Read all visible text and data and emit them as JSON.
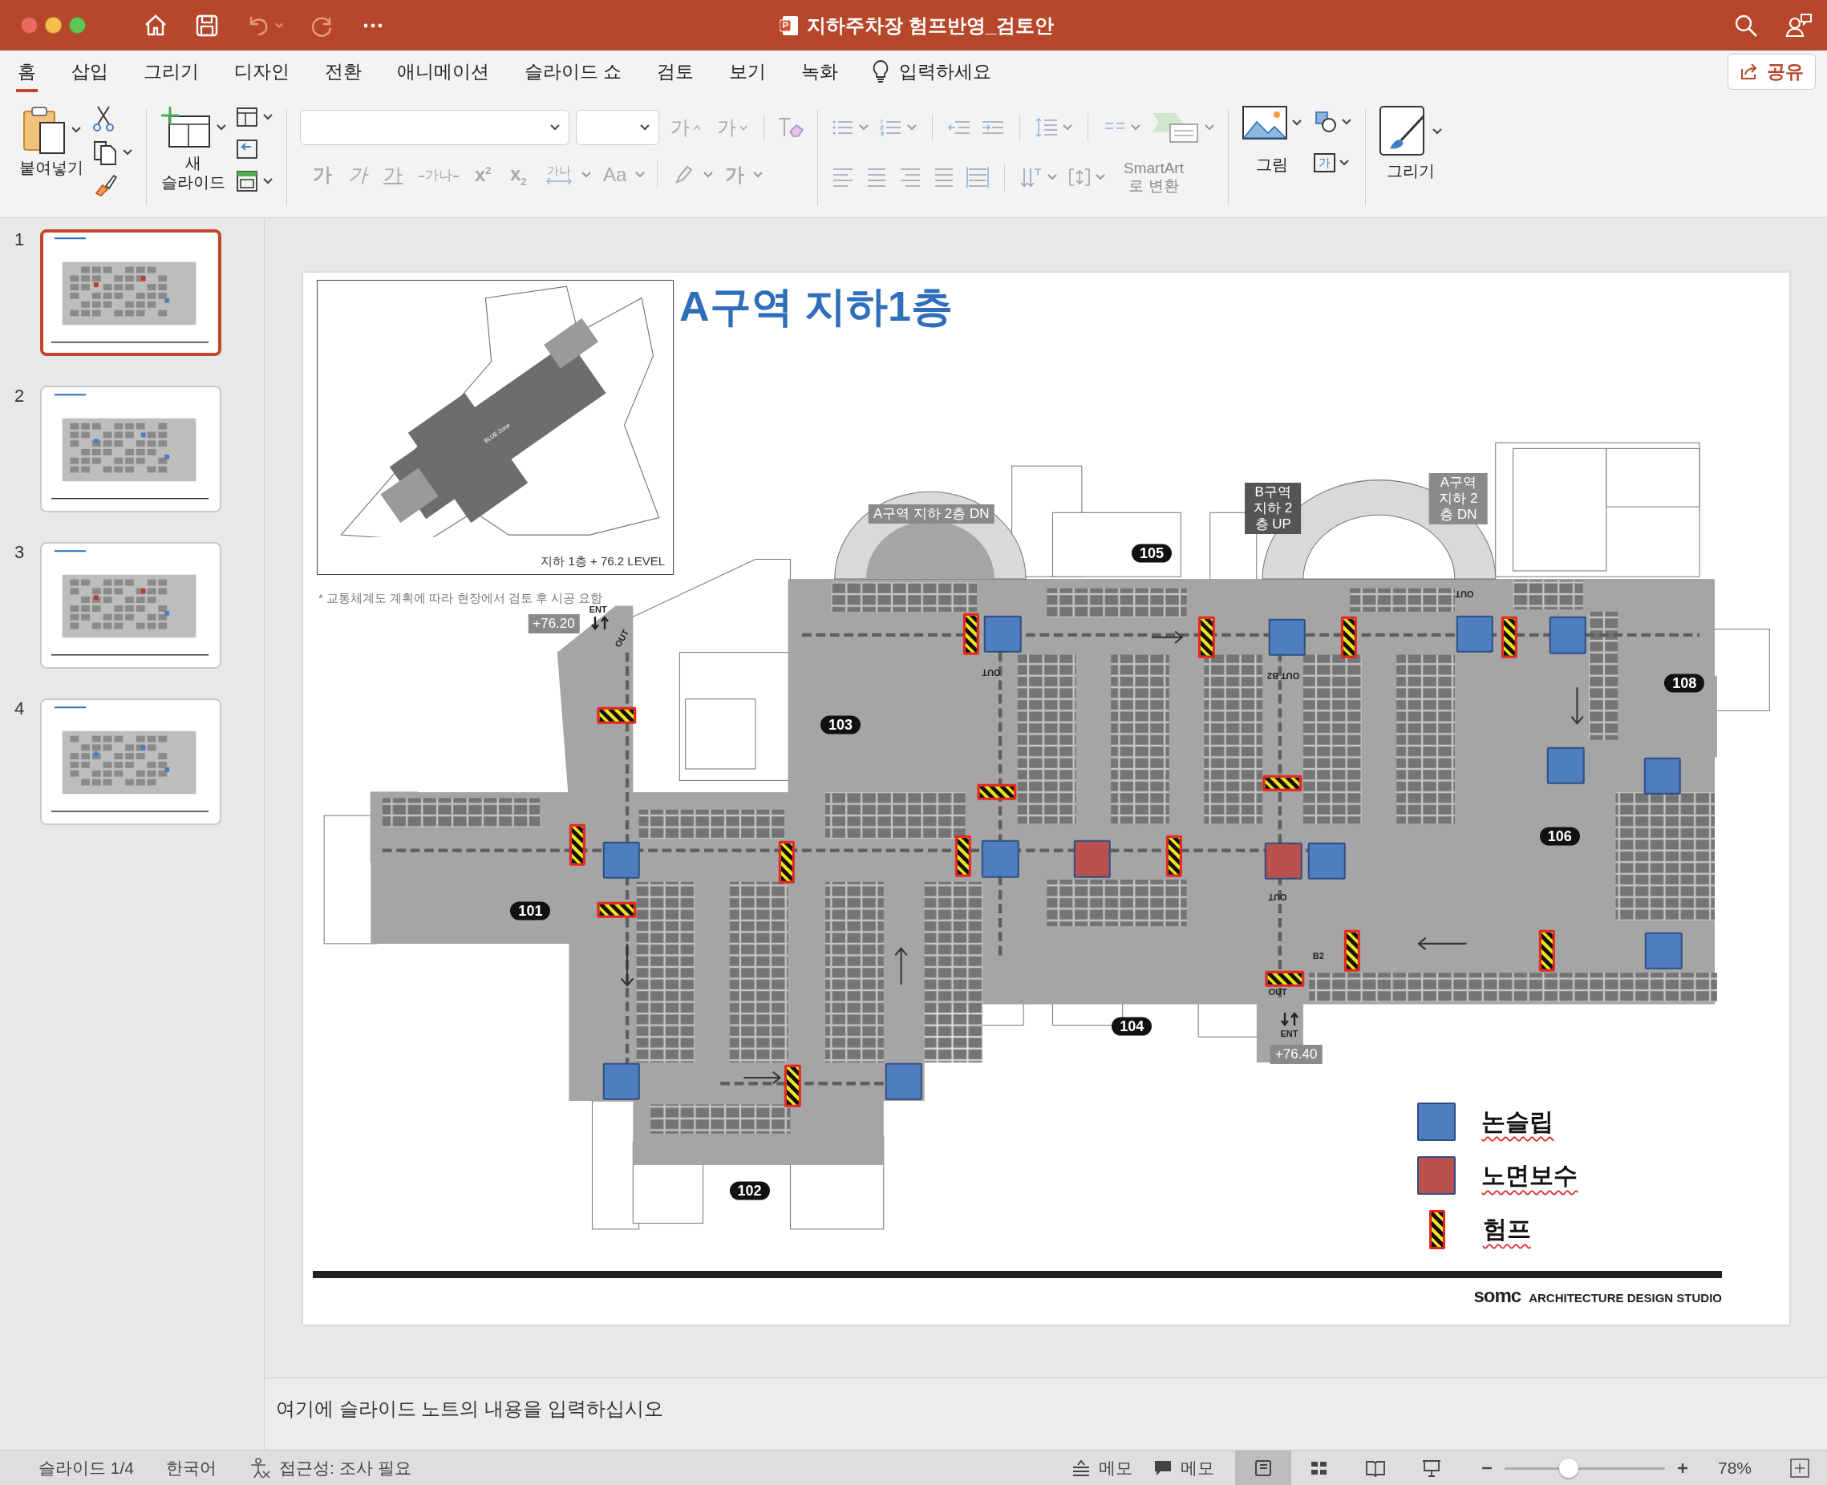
{
  "window": {
    "title": "지하주차장 험프반영_검토안"
  },
  "quick_access": [
    {
      "kind": "home",
      "disabled": false
    },
    {
      "kind": "save",
      "disabled": false
    },
    {
      "kind": "undo",
      "disabled": true
    },
    {
      "kind": "redo",
      "disabled": true
    },
    {
      "kind": "more",
      "disabled": false
    }
  ],
  "tabs": [
    {
      "label": "홈",
      "selected": true
    },
    {
      "label": "삽입",
      "selected": false
    },
    {
      "label": "그리기",
      "selected": false
    },
    {
      "label": "디자인",
      "selected": false
    },
    {
      "label": "전환",
      "selected": false
    },
    {
      "label": "애니메이션",
      "selected": false
    },
    {
      "label": "슬라이드 쇼",
      "selected": false
    },
    {
      "label": "검토",
      "selected": false
    },
    {
      "label": "보기",
      "selected": false
    },
    {
      "label": "녹화",
      "selected": false
    }
  ],
  "tell_me": {
    "label": "입력하세요"
  },
  "share_button": {
    "label": "공유"
  },
  "ribbon": {
    "paste": "붙여넣기",
    "new_slide": "새 슬라이드",
    "smartart": "SmartArt 로 변환",
    "picture": "그림",
    "draw": "그리기",
    "size_buttons": [
      {
        "kind": "grow",
        "text": "가",
        "disabled": true
      },
      {
        "kind": "shrink",
        "text": "가",
        "disabled": true
      }
    ],
    "font_buttons": [
      {
        "kind": "bold",
        "text": "가",
        "disabled": true
      },
      {
        "kind": "italic",
        "text": "가",
        "disabled": true
      },
      {
        "kind": "underline",
        "text": "가",
        "disabled": true
      },
      {
        "kind": "strike",
        "text": "가나",
        "disabled": true
      },
      {
        "kind": "superscript",
        "text": "x$^{2}$",
        "disabled": true
      },
      {
        "kind": "subscript",
        "text": "x$_{2}$",
        "disabled": true
      },
      {
        "kind": "spacing",
        "text": "가나",
        "disabled": true
      },
      {
        "kind": "case",
        "text": "Aa",
        "disabled": true
      },
      {
        "kind": "highlight",
        "disabled": true
      },
      {
        "kind": "color",
        "text": "가",
        "disabled": true
      }
    ],
    "textbox_glyph": "가"
  },
  "slides": [
    {
      "number": "1",
      "selected": true
    },
    {
      "number": "2",
      "selected": false
    },
    {
      "number": "3",
      "selected": false
    },
    {
      "number": "4",
      "selected": false
    }
  ],
  "slide": {
    "title": "A구역 지하1층",
    "inset_zone": "BLUE Zone",
    "inset_caption": "지하 1층 + 76.2 LEVEL",
    "note": "* 교통체계도 계획에 따라 현장에서 검토 후 시공 요함",
    "plan_labels": [
      {
        "kind": "sign",
        "text": "A구역 지하 2층 DN"
      },
      {
        "kind": "sign",
        "text": "B구역 지하 2층 UP"
      },
      {
        "kind": "sign",
        "text": "A구역 지하 2층 DN"
      },
      {
        "kind": "sign",
        "text": "+76.20"
      },
      {
        "kind": "mark",
        "text": "ENT"
      },
      {
        "kind": "mark",
        "text": "ENT"
      },
      {
        "kind": "sign",
        "text": "+76.40"
      },
      {
        "kind": "room",
        "text": "105"
      },
      {
        "kind": "room",
        "text": "103"
      },
      {
        "kind": "room",
        "text": "108"
      },
      {
        "kind": "room",
        "text": "106"
      },
      {
        "kind": "room",
        "text": "101"
      },
      {
        "kind": "room",
        "text": "104"
      },
      {
        "kind": "room",
        "text": "102"
      },
      {
        "kind": "mark",
        "text": "OUT"
      },
      {
        "kind": "mark",
        "text": "OUT"
      },
      {
        "kind": "mark",
        "text": "OUT"
      },
      {
        "kind": "mark",
        "text": "OUT"
      },
      {
        "kind": "mark",
        "text": "OUT"
      },
      {
        "kind": "mark",
        "text": "OUT B2"
      },
      {
        "kind": "mark",
        "text": "B2"
      }
    ],
    "markers": [
      {
        "kind": "nonslip"
      },
      {
        "kind": "nonslip"
      },
      {
        "kind": "nonslip"
      },
      {
        "kind": "nonslip"
      },
      {
        "kind": "nonslip"
      },
      {
        "kind": "nonslip"
      },
      {
        "kind": "nonslip"
      },
      {
        "kind": "nonslip"
      },
      {
        "kind": "nonslip"
      },
      {
        "kind": "nonslip"
      },
      {
        "kind": "nonslip"
      },
      {
        "kind": "nonslip"
      },
      {
        "kind": "repair"
      },
      {
        "kind": "repair"
      },
      {
        "kind": "hump"
      },
      {
        "kind": "hump"
      },
      {
        "kind": "hump"
      },
      {
        "kind": "hump"
      },
      {
        "kind": "hump"
      },
      {
        "kind": "hump"
      },
      {
        "kind": "hump"
      },
      {
        "kind": "hump"
      },
      {
        "kind": "hump"
      },
      {
        "kind": "hump"
      },
      {
        "kind": "hump"
      },
      {
        "kind": "hump"
      },
      {
        "kind": "hump"
      },
      {
        "kind": "hump"
      },
      {
        "kind": "hump"
      },
      {
        "kind": "hump"
      }
    ],
    "legend": [
      {
        "kind": "nonslip",
        "label": "논슬립"
      },
      {
        "kind": "repair",
        "label": "노면보수"
      },
      {
        "kind": "hump",
        "label": "험프"
      }
    ],
    "logo": "somc",
    "studio": "ARCHITECTURE DESIGN STUDIO"
  },
  "notes": {
    "placeholder": "여기에 슬라이드 노트의 내용을 입력하십시오"
  },
  "status_bar": {
    "slide": "슬라이드 1/4",
    "language": "한국어",
    "accessibility": "접근성: 조사 필요",
    "notes": "메모",
    "comments": "메모",
    "views": [
      {
        "kind": "normal",
        "selected": true
      },
      {
        "kind": "sorter",
        "selected": false
      },
      {
        "kind": "reading",
        "selected": false
      },
      {
        "kind": "slideshow",
        "selected": false
      }
    ],
    "zoom": {
      "level": 0.4,
      "reading": "78%"
    }
  }
}
